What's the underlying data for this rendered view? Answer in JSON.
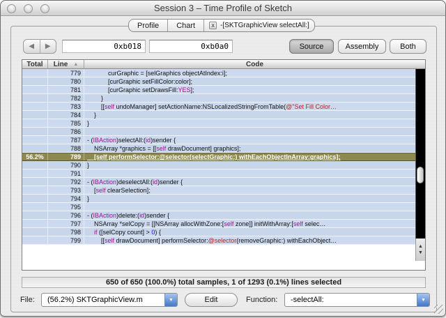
{
  "window": {
    "title": "Session 3 – Time Profile of Sketch"
  },
  "tabs": [
    {
      "label": "Profile"
    },
    {
      "label": "Chart"
    },
    {
      "label": "-[SKTGraphicView selectAll:]",
      "close_icon": "x"
    }
  ],
  "toolbar": {
    "back_icon": "◀",
    "forward_icon": "▶",
    "address1": "0xb018",
    "address2": "0xb0a0",
    "source_label": "Source",
    "assembly_label": "Assembly",
    "both_label": "Both",
    "selected_view": "Source"
  },
  "table": {
    "columns": {
      "total": "Total",
      "line": "Line",
      "code": "Code"
    },
    "sort_column": "Line",
    "sort_indicator": "▲",
    "rows": [
      {
        "total": "",
        "line": "779",
        "hl": false,
        "segs": [
          [
            "p",
            "            curGraphic = [selGraphics objectAtIndex:i];"
          ]
        ]
      },
      {
        "total": "",
        "line": "780",
        "hl": false,
        "segs": [
          [
            "p",
            "            [curGraphic setFillColor:color];"
          ]
        ]
      },
      {
        "total": "",
        "line": "781",
        "hl": false,
        "segs": [
          [
            "p",
            "            [curGraphic setDrawsFill:"
          ],
          [
            "k",
            "YES"
          ],
          [
            "p",
            "];"
          ]
        ]
      },
      {
        "total": "",
        "line": "782",
        "hl": false,
        "segs": [
          [
            "p",
            "        }"
          ]
        ]
      },
      {
        "total": "",
        "line": "783",
        "hl": false,
        "segs": [
          [
            "p",
            "        [["
          ],
          [
            "k",
            "self"
          ],
          [
            "p",
            " undoManager] setActionName:NSLocalizedStringFromTable("
          ],
          [
            "s",
            "@\"Set Fill Color…"
          ]
        ]
      },
      {
        "total": "",
        "line": "784",
        "hl": false,
        "segs": [
          [
            "p",
            "    }"
          ]
        ]
      },
      {
        "total": "",
        "line": "785",
        "hl": false,
        "segs": [
          [
            "p",
            "}"
          ]
        ]
      },
      {
        "total": "",
        "line": "786",
        "hl": false,
        "segs": []
      },
      {
        "total": "",
        "line": "787",
        "hl": false,
        "segs": [
          [
            "p",
            "- ("
          ],
          [
            "k",
            "IBAction"
          ],
          [
            "p",
            ")selectAll:("
          ],
          [
            "k",
            "id"
          ],
          [
            "p",
            ")sender {"
          ]
        ]
      },
      {
        "total": "",
        "line": "788",
        "hl": false,
        "segs": [
          [
            "p",
            "    NSArray *graphics = [["
          ],
          [
            "k",
            "self"
          ],
          [
            "p",
            " drawDocument] graphics];"
          ]
        ]
      },
      {
        "total": "56.2%",
        "line": "789",
        "hl": true,
        "segs": [
          [
            "p",
            "    [self performSelector:@selector(selectGraphic:) withEachObjectInArray:graphics];"
          ]
        ]
      },
      {
        "total": "",
        "line": "790",
        "hl": false,
        "segs": [
          [
            "p",
            "}"
          ]
        ]
      },
      {
        "total": "",
        "line": "791",
        "hl": false,
        "segs": []
      },
      {
        "total": "",
        "line": "792",
        "hl": false,
        "segs": [
          [
            "p",
            "- ("
          ],
          [
            "k",
            "IBAction"
          ],
          [
            "p",
            ")deselectAll:("
          ],
          [
            "k",
            "id"
          ],
          [
            "p",
            ")sender {"
          ]
        ]
      },
      {
        "total": "",
        "line": "793",
        "hl": false,
        "segs": [
          [
            "p",
            "    ["
          ],
          [
            "k",
            "self"
          ],
          [
            "p",
            " clearSelection];"
          ]
        ]
      },
      {
        "total": "",
        "line": "794",
        "hl": false,
        "segs": [
          [
            "p",
            "}"
          ]
        ]
      },
      {
        "total": "",
        "line": "795",
        "hl": false,
        "segs": []
      },
      {
        "total": "",
        "line": "796",
        "hl": false,
        "segs": [
          [
            "p",
            "- ("
          ],
          [
            "k",
            "IBAction"
          ],
          [
            "p",
            ")delete:("
          ],
          [
            "k",
            "id"
          ],
          [
            "p",
            ")sender {"
          ]
        ]
      },
      {
        "total": "",
        "line": "797",
        "hl": false,
        "segs": [
          [
            "p",
            "    NSArray *selCopy = [[NSArray allocWithZone:["
          ],
          [
            "k",
            "self"
          ],
          [
            "p",
            " zone]] initWithArray:["
          ],
          [
            "k",
            "self"
          ],
          [
            "p",
            " selec…"
          ]
        ]
      },
      {
        "total": "",
        "line": "798",
        "hl": false,
        "segs": [
          [
            "p",
            "    "
          ],
          [
            "k",
            "if"
          ],
          [
            "p",
            " ([selCopy count] > "
          ],
          [
            "n",
            "0"
          ],
          [
            "p",
            ") {"
          ]
        ]
      },
      {
        "total": "",
        "line": "799",
        "hl": false,
        "segs": [
          [
            "p",
            "        [["
          ],
          [
            "k",
            "self"
          ],
          [
            "p",
            " drawDocument] performSelector:"
          ],
          [
            "s",
            "@selector"
          ],
          [
            "p",
            "(removeGraphic:) withEachObject…"
          ]
        ]
      }
    ]
  },
  "status": "650 of 650 (100.0%) total samples, 1 of 1293 (0.1%) lines selected",
  "footer": {
    "file_label": "File:",
    "file_value": "(56.2%) SKTGraphicView.m",
    "edit_label": "Edit",
    "function_label": "Function:",
    "function_value": "-selectAll:"
  },
  "colors": {
    "keyword": "#aa0d91",
    "number": "#1c00cf",
    "string": "#c41a16",
    "highlight_bg": "#8e8950",
    "row_blue": "#ccd9ee",
    "row_blue_alt": "#c8d6ec"
  }
}
